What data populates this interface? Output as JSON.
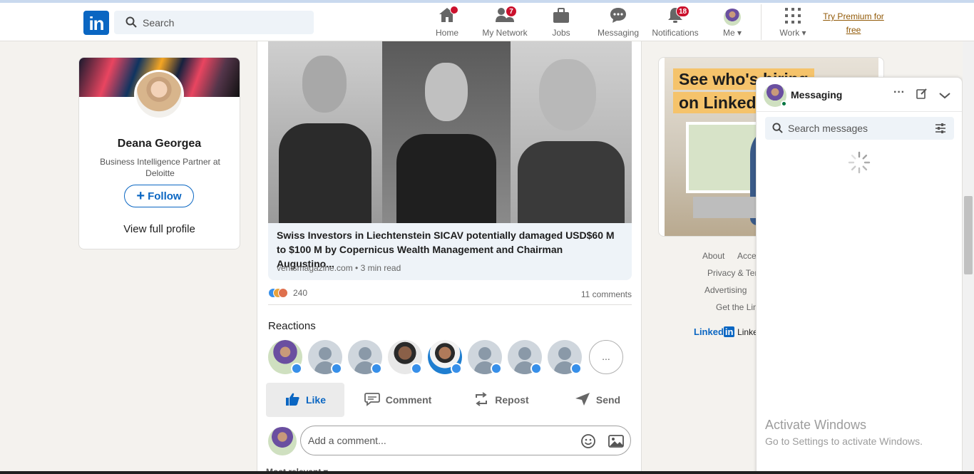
{
  "nav": {
    "search_placeholder": "Search",
    "items": [
      {
        "label": "Home",
        "badge": ""
      },
      {
        "label": "My Network",
        "badge": "7"
      },
      {
        "label": "Jobs",
        "badge": ""
      },
      {
        "label": "Messaging",
        "badge": ""
      },
      {
        "label": "Notifications",
        "badge": "18"
      },
      {
        "label": "Me",
        "badge": ""
      },
      {
        "label": "Work",
        "badge": ""
      }
    ],
    "premium": "Try Premium for free"
  },
  "profile": {
    "name": "Deana Georgea",
    "title": "Business Intelligence Partner at Deloitte",
    "follow": "Follow",
    "view_full": "View full profile"
  },
  "post": {
    "article_title": "Swiss Investors in Liechtenstein SICAV potentially damaged USD$60 M to $100 M by Copernicus Wealth Management and Chairman Augustino...",
    "article_meta": "ventsmagazine.com • 3 min read",
    "reaction_count": "240",
    "comments_count": "11 comments",
    "reactions_title": "Reactions",
    "more_reactions": "...",
    "actions": {
      "like": "Like",
      "comment": "Comment",
      "repost": "Repost",
      "send": "Send"
    },
    "comment_placeholder": "Add a comment...",
    "sort_label": "Most relevant"
  },
  "ad": {
    "line1": "See who's hiring",
    "line2": "on LinkedIn"
  },
  "footer": {
    "about": "About",
    "access": "Accessibility",
    "privacy": "Privacy & Terms",
    "advertising": "Advertising",
    "get_app": "Get the LinkedIn app",
    "brand": "LinkedIn Corporation"
  },
  "messaging": {
    "title": "Messaging",
    "search_placeholder": "Search messages"
  },
  "activate": {
    "line1": "Activate Windows",
    "line2": "Go to Settings to activate Windows."
  },
  "colors": {
    "brand": "#0a66c2",
    "badge": "#cb112d",
    "premium": "#915907",
    "ad_highlight": "#f5c36b"
  }
}
